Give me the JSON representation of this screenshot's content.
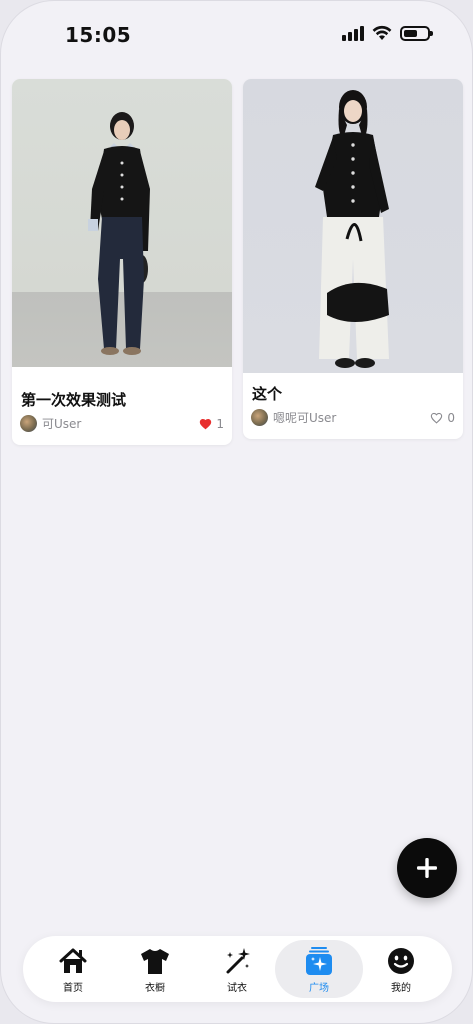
{
  "status_bar": {
    "time": "15:05"
  },
  "feed": {
    "posts": [
      {
        "title": "第一次效果测试",
        "author": "可User",
        "likes": "1",
        "liked": true
      },
      {
        "title": "这个",
        "author": "嗯呢可User",
        "likes": "0",
        "liked": false
      }
    ]
  },
  "fab": {
    "icon": "plus-icon"
  },
  "tabbar": {
    "tabs": [
      {
        "label": "首页",
        "icon": "home-icon"
      },
      {
        "label": "衣橱",
        "icon": "tshirt-icon"
      },
      {
        "label": "试衣",
        "icon": "magic-wand-icon"
      },
      {
        "label": "广场",
        "icon": "plaza-sparkle-icon"
      },
      {
        "label": "我的",
        "icon": "smiley-icon"
      }
    ],
    "active_index": 3
  },
  "colors": {
    "accent": "#1e8cf0",
    "like": "#e8302f",
    "fab": "#0b0b0b"
  }
}
